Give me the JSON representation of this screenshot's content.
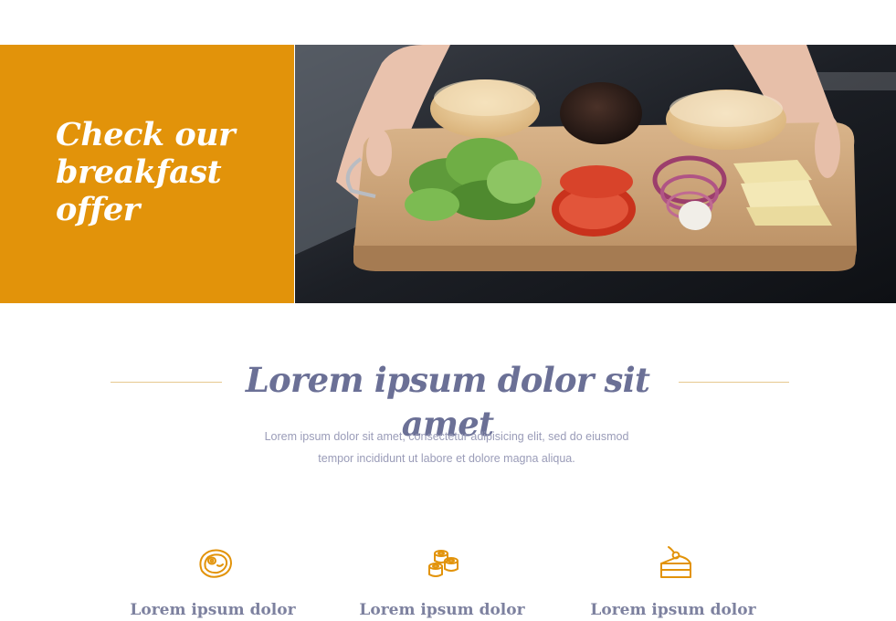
{
  "promo": {
    "title": "Check our breakfast offer",
    "background_color": "#e2930a"
  },
  "hero_photo": {
    "icon": "burger-ingredients-photo"
  },
  "section": {
    "title": "Lorem ipsum dolor sit amet",
    "description": "Lorem ipsum dolor sit amet, consectetur adipisicing elit, sed do eiusmod tempor incididunt ut labore et dolore magna aliqua.",
    "line_color": "#e6c98f",
    "title_color": "#6b7096"
  },
  "features": [
    {
      "icon": "steak-icon",
      "label": "Lorem ipsum dolor"
    },
    {
      "icon": "sushi-rolls-icon",
      "label": "Lorem ipsum dolor"
    },
    {
      "icon": "cake-slice-icon",
      "label": "Lorem ipsum dolor"
    }
  ],
  "accent_color": "#e2930a"
}
